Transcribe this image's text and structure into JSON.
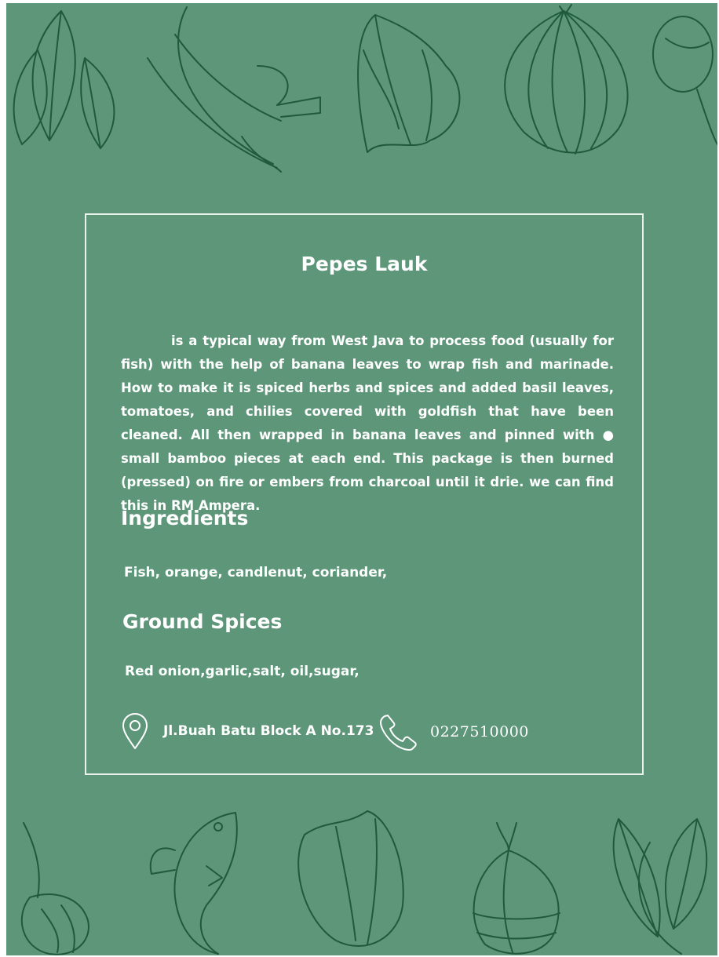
{
  "colors": {
    "background": "#5d9679",
    "doodle_line": "#1f5a3c",
    "card_border": "#e9f3ec",
    "text": "#ffffff"
  },
  "icons": {
    "location": "map-pin-icon",
    "phone": "phone-icon"
  },
  "card": {
    "title": "Pepes Lauk",
    "description": "is a typical way from West Java to process food (usually for fish) with the help of banana leaves to wrap fish and marinade. How to make it is spiced herbs and spices and added basil leaves, tomatoes, and chilies covered with goldfish that have been cleaned. All then wrapped in banana leaves and pinned with ● small bamboo pieces at each end. This package is then burned (pressed) on fire or embers from charcoal until it drie. we can find this in RM Ampera.",
    "ingredients_heading": "Ingredients",
    "ingredients": "Fish, orange, candlenut, coriander,",
    "spices_heading": "Ground Spices",
    "spices": "Red onion,garlic,salt, oil,sugar,",
    "address": "Jl.Buah Batu Block A No.173",
    "phone": "0227510000"
  }
}
